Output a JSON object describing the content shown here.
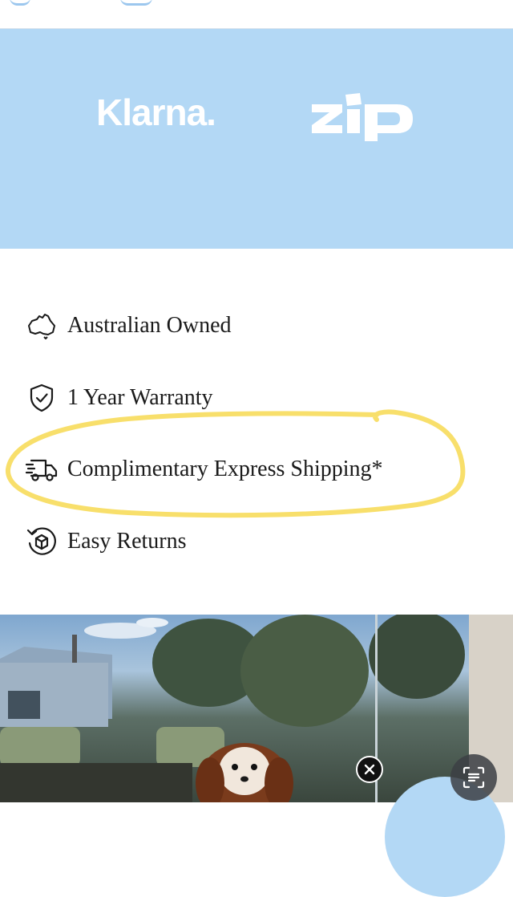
{
  "payment_logos": {
    "klarna": "Klarna.",
    "zip": "zip"
  },
  "features": [
    {
      "icon": "australia-map-icon",
      "label": "Australian Owned"
    },
    {
      "icon": "shield-check-icon",
      "label": "1 Year Warranty"
    },
    {
      "icon": "delivery-truck-icon",
      "label": "Complimentary Express Shipping*"
    },
    {
      "icon": "return-box-icon",
      "label": "Easy Returns"
    }
  ],
  "colors": {
    "payment_band": "#b3d8f5",
    "highlight_marker": "#f7dc5b",
    "text": "#1a1a1a"
  },
  "overlay": {
    "close_icon": "close-icon",
    "lens_icon": "visual-search-icon"
  }
}
